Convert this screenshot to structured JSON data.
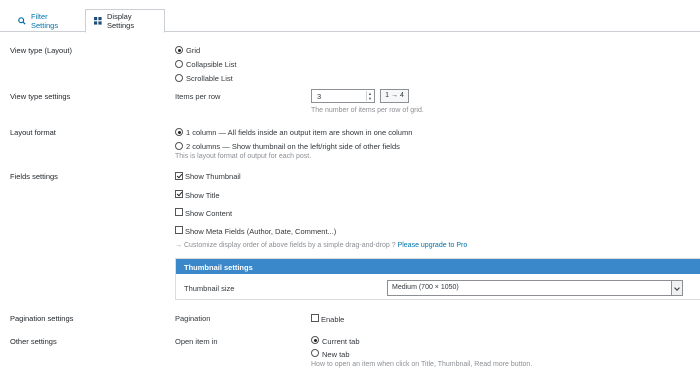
{
  "tabs": [
    {
      "label": "Filter Settings",
      "icon": "search-icon"
    },
    {
      "label": "Display Settings",
      "icon": "grid-icon",
      "active": true
    }
  ],
  "view_type": {
    "label": "View type (Layout)",
    "options": [
      "Grid",
      "Collapsible List",
      "Scrollable List"
    ],
    "selected": "Grid"
  },
  "view_type_settings": {
    "label": "View type settings",
    "items_per_row_label": "Items per row",
    "items_per_row_value": "3",
    "range": "1 → 4",
    "description": "The number of items per row of grid."
  },
  "layout_format": {
    "label": "Layout format",
    "options": [
      "1 column — All fields inside an output item are shown in one column",
      "2 columns — Show thumbnail on the left/right side of other fields"
    ],
    "selected": 0,
    "description": "This is layout format of output for each post."
  },
  "fields_settings": {
    "label": "Fields settings",
    "checkboxes": [
      {
        "label": "Show Thumbnail",
        "checked": true
      },
      {
        "label": "Show Title",
        "checked": true
      },
      {
        "label": "Show Content",
        "checked": false
      },
      {
        "label": "Show Meta Fields (Author, Date, Comment...)",
        "checked": false
      }
    ],
    "note": "→ Customize display order of above fields by a simple drag-and-drop ?",
    "upgrade_link": "Please upgrade to Pro"
  },
  "thumbnail_settings": {
    "header": "Thumbnail settings",
    "size_label": "Thumbnail size",
    "size_value": "Medium (700 × 1050)"
  },
  "pagination_settings": {
    "label": "Pagination settings",
    "field_label": "Pagination",
    "checkbox_label": "Enable",
    "checked": false
  },
  "other_settings": {
    "label": "Other settings",
    "open_item_label": "Open item in",
    "options": [
      "Current tab",
      "New tab"
    ],
    "selected": "Current tab",
    "description": "How to open an item when click on Title, Thumbnail, Read more button."
  },
  "colors": {
    "accent": "#0073aa",
    "panel_header": "#3a87c9"
  }
}
